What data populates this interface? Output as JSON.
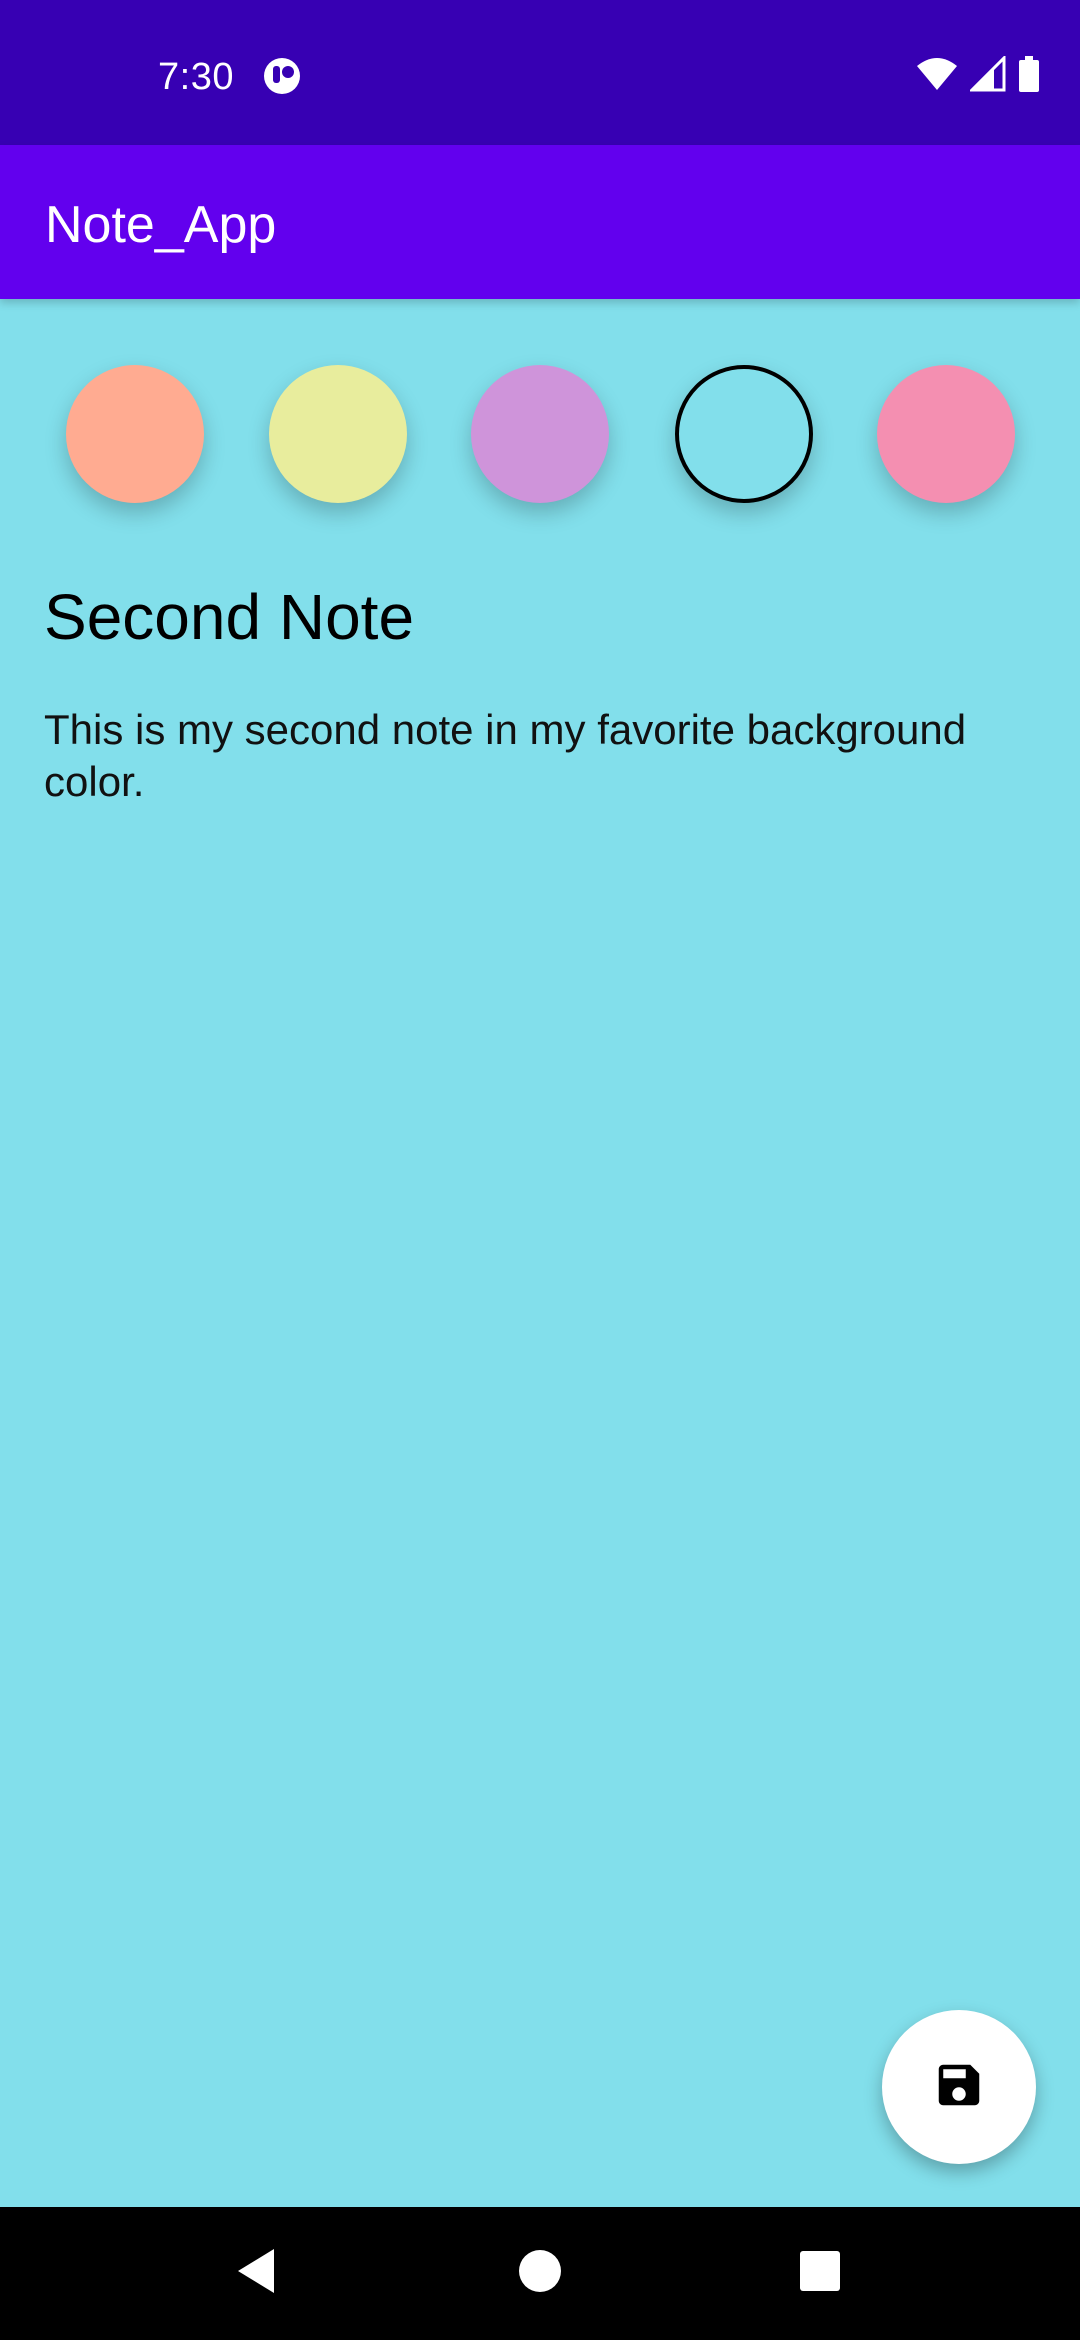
{
  "status_bar": {
    "time": "7:30",
    "icons": [
      "notification-app-icon",
      "wifi-icon",
      "cell-signal-icon",
      "battery-icon"
    ]
  },
  "app_bar": {
    "title": "Note_App"
  },
  "color_picker": {
    "swatches": [
      {
        "name": "peach",
        "color": "#ffab91"
      },
      {
        "name": "yellow",
        "color": "#e8ed9d"
      },
      {
        "name": "lavender",
        "color": "#cf94da"
      },
      {
        "name": "cyan",
        "color": "#82dfeb",
        "selected": true
      },
      {
        "name": "pink",
        "color": "#f48fb1"
      }
    ]
  },
  "note": {
    "title": "Second Note",
    "body": "This is my second note in my favorite background color."
  },
  "fab": {
    "icon": "save-icon"
  },
  "nav_bar": {
    "icons": [
      "back-icon",
      "home-icon",
      "recents-icon"
    ]
  },
  "colors": {
    "status_bar": "#3700b3",
    "app_bar": "#6200ee",
    "background": "#82dfeb"
  }
}
